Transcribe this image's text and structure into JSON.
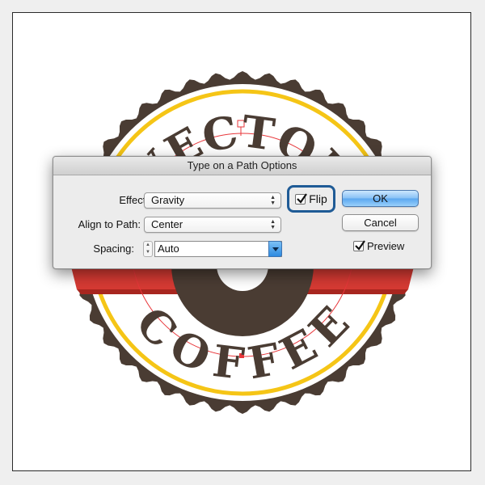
{
  "artwork": {
    "top_text": "VECTOR",
    "bottom_text": "COFFEE",
    "colors": {
      "brown": "#4a3c33",
      "yellow": "#f5c516",
      "red": "#d63a33",
      "cream": "#ffffff",
      "path_guide": "#e8363a"
    }
  },
  "dialog": {
    "title": "Type on a Path Options",
    "effect": {
      "label": "Effect:",
      "value": "Gravity"
    },
    "align": {
      "label": "Align to Path:",
      "value": "Center"
    },
    "spacing": {
      "label": "Spacing:",
      "value": "Auto"
    },
    "flip": {
      "label": "Flip",
      "checked": true
    },
    "ok_label": "OK",
    "cancel_label": "Cancel",
    "preview": {
      "label": "Preview",
      "checked": true
    }
  }
}
